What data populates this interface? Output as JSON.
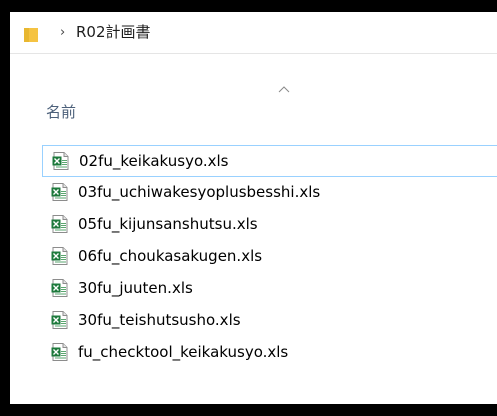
{
  "address_bar": {
    "folder_icon": "folder-icon",
    "separator": "›",
    "current_folder": "R02計画書"
  },
  "column_header": {
    "sort_indicator": "chevron-up-icon",
    "name_label": "名前"
  },
  "files": [
    {
      "name": "02fu_keikakusyo.xls",
      "icon": "excel-file-icon",
      "selected": true
    },
    {
      "name": "03fu_uchiwakesyoplusbesshi.xls",
      "icon": "excel-file-icon",
      "selected": false
    },
    {
      "name": "05fu_kijunsanshutsu.xls",
      "icon": "excel-file-icon",
      "selected": false
    },
    {
      "name": "06fu_choukasakugen.xls",
      "icon": "excel-file-icon",
      "selected": false
    },
    {
      "name": "30fu_juuten.xls",
      "icon": "excel-file-icon",
      "selected": false
    },
    {
      "name": "30fu_teishutsusho.xls",
      "icon": "excel-file-icon",
      "selected": false
    },
    {
      "name": "fu_checktool_keikakusyo.xls",
      "icon": "excel-file-icon",
      "selected": false
    }
  ],
  "colors": {
    "folder": "#f5c342",
    "excel_green": "#1d7a3c",
    "header_text": "#4c607a",
    "selection_border": "#99d1ff"
  }
}
